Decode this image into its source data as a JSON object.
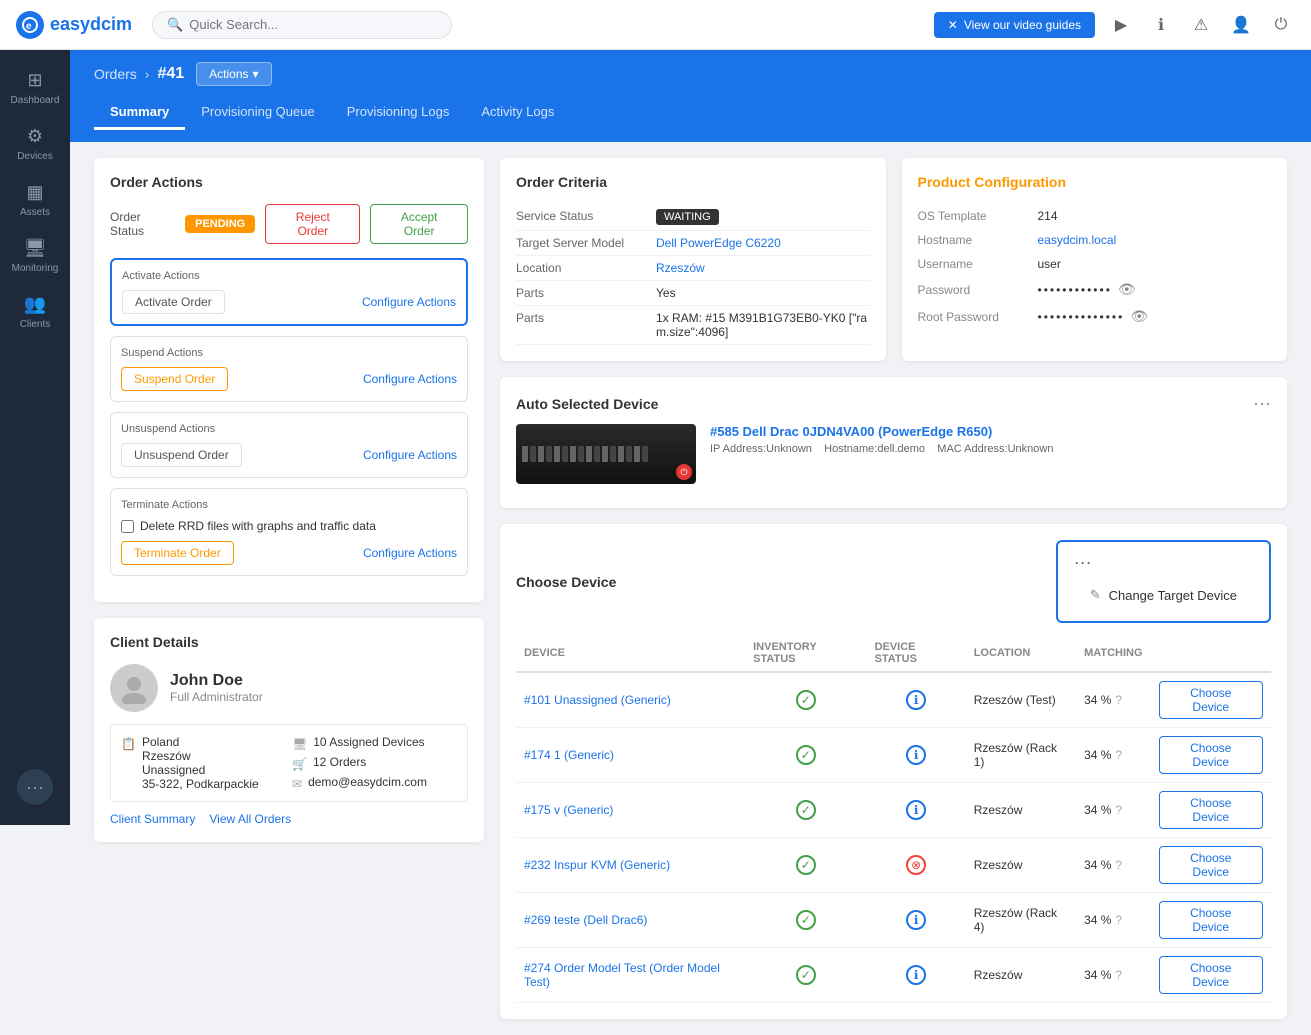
{
  "app": {
    "logo_text": "easydcim",
    "logo_letter": "e"
  },
  "top_nav": {
    "search_placeholder": "Quick Search...",
    "video_btn_label": "View our video guides"
  },
  "sidebar": {
    "items": [
      {
        "id": "dashboard",
        "label": "Dashboard",
        "icon": "⊞",
        "active": false
      },
      {
        "id": "devices",
        "label": "Devices",
        "icon": "⊡",
        "active": false
      },
      {
        "id": "assets",
        "label": "Assets",
        "icon": "▦",
        "active": false
      },
      {
        "id": "monitoring",
        "label": "Monitoring",
        "icon": "🖥",
        "active": false
      },
      {
        "id": "clients",
        "label": "Clients",
        "icon": "👥",
        "active": false
      }
    ]
  },
  "breadcrumb": {
    "parent": "Orders",
    "current": "#41",
    "actions_label": "Actions"
  },
  "tabs": [
    {
      "id": "summary",
      "label": "Summary",
      "active": true
    },
    {
      "id": "provisioning-queue",
      "label": "Provisioning Queue",
      "active": false
    },
    {
      "id": "provisioning-logs",
      "label": "Provisioning Logs",
      "active": false
    },
    {
      "id": "activity-logs",
      "label": "Activity Logs",
      "active": false
    }
  ],
  "order_actions": {
    "title": "Order Actions",
    "status_label": "Order Status",
    "status_value": "PENDING",
    "reject_label": "Reject Order",
    "accept_label": "Accept Order",
    "activate_section": {
      "label": "Activate Actions",
      "btn_label": "Activate Order",
      "configure_label": "Configure Actions"
    },
    "suspend_section": {
      "label": "Suspend Actions",
      "btn_label": "Suspend Order",
      "configure_label": "Configure Actions"
    },
    "unsuspend_section": {
      "label": "Unsuspend Actions",
      "btn_label": "Unsuspend Order",
      "configure_label": "Configure Actions"
    },
    "terminate_section": {
      "label": "Terminate Actions",
      "checkbox_label": "Delete RRD files with graphs and traffic data",
      "btn_label": "Terminate Order",
      "configure_label": "Configure Actions"
    }
  },
  "order_criteria": {
    "title": "Order Criteria",
    "rows": [
      {
        "label": "Service Status",
        "value": "WAITING",
        "type": "badge"
      },
      {
        "label": "Target Server Model",
        "value": "Dell PowerEdge C6220",
        "type": "link"
      },
      {
        "label": "Location",
        "value": "Rzeszów",
        "type": "link"
      },
      {
        "label": "Parts",
        "value": "Yes",
        "type": "text"
      },
      {
        "label": "Parts",
        "value": "1x RAM: #15 M391B1G73EB0-YK0 [\"ram.size\":4096]",
        "type": "text"
      }
    ]
  },
  "product_config": {
    "title": "Product Configuration",
    "rows": [
      {
        "label": "OS Template",
        "value": "214",
        "type": "text"
      },
      {
        "label": "Hostname",
        "value": "easydcim.local",
        "type": "link"
      },
      {
        "label": "Username",
        "value": "user",
        "type": "text"
      },
      {
        "label": "Password",
        "value": "••••••••••••",
        "type": "password"
      },
      {
        "label": "Root Password",
        "value": "••••••••••••••",
        "type": "password"
      }
    ]
  },
  "auto_selected_device": {
    "title": "Auto Selected Device",
    "device_id": "#585",
    "device_name": "Dell Drac 0JDN4VA00 (PowerEdge R650)",
    "device_link": "#585 Dell Drac 0JDN4VA00 (PowerEdge R650)",
    "ip": "IP Address:Unknown",
    "hostname": "Hostname:dell.demo",
    "mac": "MAC Address:Unknown"
  },
  "client_details": {
    "title": "Client Details",
    "name": "John Doe",
    "role": "Full Administrator",
    "info": {
      "country": "Poland",
      "city": "Rzeszów",
      "unassigned": "Unassigned",
      "postal": "35-322, Podkarpackie",
      "assigned_devices": "10 Assigned Devices",
      "orders": "12 Orders",
      "email": "demo@easydcim.com"
    },
    "links": [
      {
        "label": "Client Summary"
      },
      {
        "label": "View All Orders"
      }
    ]
  },
  "choose_device": {
    "title": "Choose Device",
    "dropdown_item": "Change Target Device",
    "columns": [
      "DEVICE",
      "INVENTORY STATUS",
      "DEVICE STATUS",
      "LOCATION",
      "MATCHING",
      ""
    ],
    "rows": [
      {
        "id": "#101",
        "name": "Unassigned (Generic)",
        "inv_status": "ok",
        "dev_status": "info",
        "location": "Rzeszów (Test)",
        "matching": "34 %",
        "btn": "Choose Device"
      },
      {
        "id": "#174",
        "name": "1 (Generic)",
        "inv_status": "ok",
        "dev_status": "info",
        "location": "Rzeszów (Rack 1)",
        "matching": "34 %",
        "btn": "Choose Device"
      },
      {
        "id": "#175",
        "name": "v (Generic)",
        "inv_status": "ok",
        "dev_status": "info",
        "location": "Rzeszów",
        "matching": "34 %",
        "btn": "Choose Device"
      },
      {
        "id": "#232",
        "name": "Inspur KVM (Generic)",
        "inv_status": "ok",
        "dev_status": "warning",
        "location": "Rzeszów",
        "matching": "34 %",
        "btn": "Choose Device"
      },
      {
        "id": "#269",
        "name": "teste (Dell Drac6)",
        "inv_status": "ok",
        "dev_status": "info",
        "location": "Rzeszów (Rack 4)",
        "matching": "34 %",
        "btn": "Choose Device"
      },
      {
        "id": "#274",
        "name": "Order Model Test (Order Model Test)",
        "inv_status": "ok",
        "dev_status": "info",
        "location": "Rzeszów",
        "matching": "34 %",
        "btn": "Choose Device"
      }
    ]
  }
}
